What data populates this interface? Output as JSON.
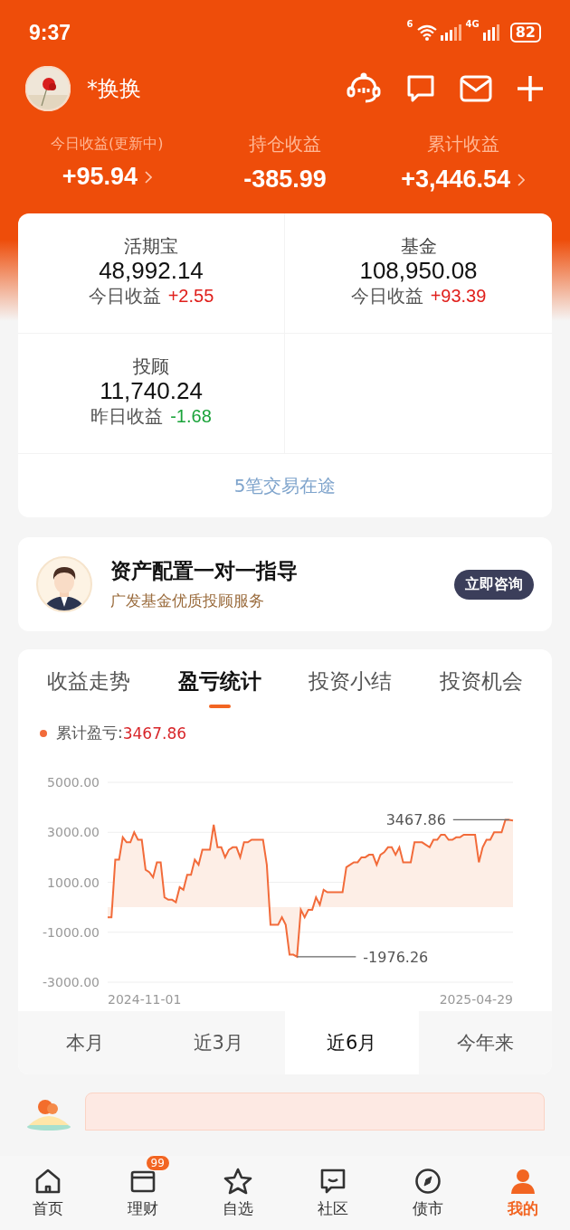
{
  "status_bar": {
    "time": "9:37",
    "wifi_label": "6",
    "network_label": "4G",
    "battery": "82"
  },
  "profile": {
    "name": "*换换"
  },
  "summary": [
    {
      "label": "今日收益(更新中)",
      "value": "+95.94",
      "has_arrow": true
    },
    {
      "label": "持仓收益",
      "value": "-385.99",
      "has_arrow": false
    },
    {
      "label": "累计收益",
      "value": "+3,446.54",
      "has_arrow": true
    }
  ],
  "assets": [
    {
      "name": "活期宝",
      "amount": "48,992.14",
      "income_label": "今日收益",
      "income": "+2.55",
      "color": "#e0201c"
    },
    {
      "name": "基金",
      "amount": "108,950.08",
      "income_label": "今日收益",
      "income": "+93.39",
      "color": "#e0201c"
    },
    {
      "name": "投顾",
      "amount": "11,740.24",
      "income_label": "昨日收益",
      "income": "-1.68",
      "color": "#1aa33a"
    }
  ],
  "in_transit": "5笔交易在途",
  "advisor": {
    "title": "资产配置一对一指导",
    "subtitle": "广发基金优质投顾服务",
    "button": "立即咨询"
  },
  "analysis": {
    "tabs": [
      {
        "label": "收益走势",
        "selected": false
      },
      {
        "label": "盈亏统计",
        "selected": true
      },
      {
        "label": "投资小结",
        "selected": false
      },
      {
        "label": "投资机会",
        "selected": false
      }
    ],
    "legend": {
      "separator": ":",
      "value": "3467.86"
    },
    "axis_start": "2024-11-01",
    "axis_end": "2025-04-29",
    "chart_data": {
      "type": "area",
      "grid": true,
      "ylim": [
        -3000,
        5000
      ],
      "yticks": [
        {
          "value": 5000,
          "label": "5000.00"
        },
        {
          "value": 3000,
          "label": "3000.00"
        },
        {
          "value": 1000,
          "label": "1000.00"
        },
        {
          "value": -1000,
          "label": "-1000.00"
        },
        {
          "value": -3000,
          "label": "-3000.00"
        }
      ],
      "series": [
        {
          "name": "累计盈亏",
          "color": "#f26b3a",
          "values": [
            -400,
            -400,
            1900,
            1900,
            2800,
            2600,
            2600,
            3000,
            2700,
            2700,
            1500,
            1400,
            1200,
            1800,
            1800,
            400,
            300,
            300,
            200,
            800,
            700,
            1300,
            1300,
            1900,
            1700,
            2300,
            2300,
            2300,
            3300,
            2400,
            2400,
            2000,
            2300,
            2400,
            2400,
            2000,
            2600,
            2600,
            2700,
            2700,
            2700,
            2700,
            1700,
            -700,
            -700,
            -700,
            -400,
            -700,
            -1900,
            -1900,
            -1980,
            -100,
            -400,
            -100,
            -100,
            400,
            100,
            700,
            600,
            600,
            600,
            600,
            600,
            1600,
            1700,
            1800,
            1800,
            2000,
            2000,
            2100,
            2100,
            1700,
            2100,
            2200,
            2400,
            2400,
            2100,
            2400,
            1800,
            1800,
            1800,
            2600,
            2600,
            2600,
            2500,
            2400,
            2700,
            2700,
            2900,
            2900,
            2700,
            2700,
            2800,
            2800,
            2900,
            2900,
            2900,
            2900,
            1800,
            2400,
            2700,
            2700,
            3000,
            3000,
            3000,
            3500,
            3500,
            3470
          ]
        }
      ],
      "annotations": [
        "3467.86",
        "-1976.26"
      ]
    },
    "periods": [
      {
        "label": "本月",
        "selected": false
      },
      {
        "label": "近3月",
        "selected": false
      },
      {
        "label": "近6月",
        "selected": true
      },
      {
        "label": "今年来",
        "selected": false
      }
    ]
  },
  "nav": [
    {
      "label": "首页",
      "selected": false
    },
    {
      "label": "理财",
      "selected": false,
      "badge": "99"
    },
    {
      "label": "自选",
      "selected": false
    },
    {
      "label": "社区",
      "selected": false
    },
    {
      "label": "债市",
      "selected": false
    },
    {
      "label": "我的",
      "selected": true
    }
  ]
}
